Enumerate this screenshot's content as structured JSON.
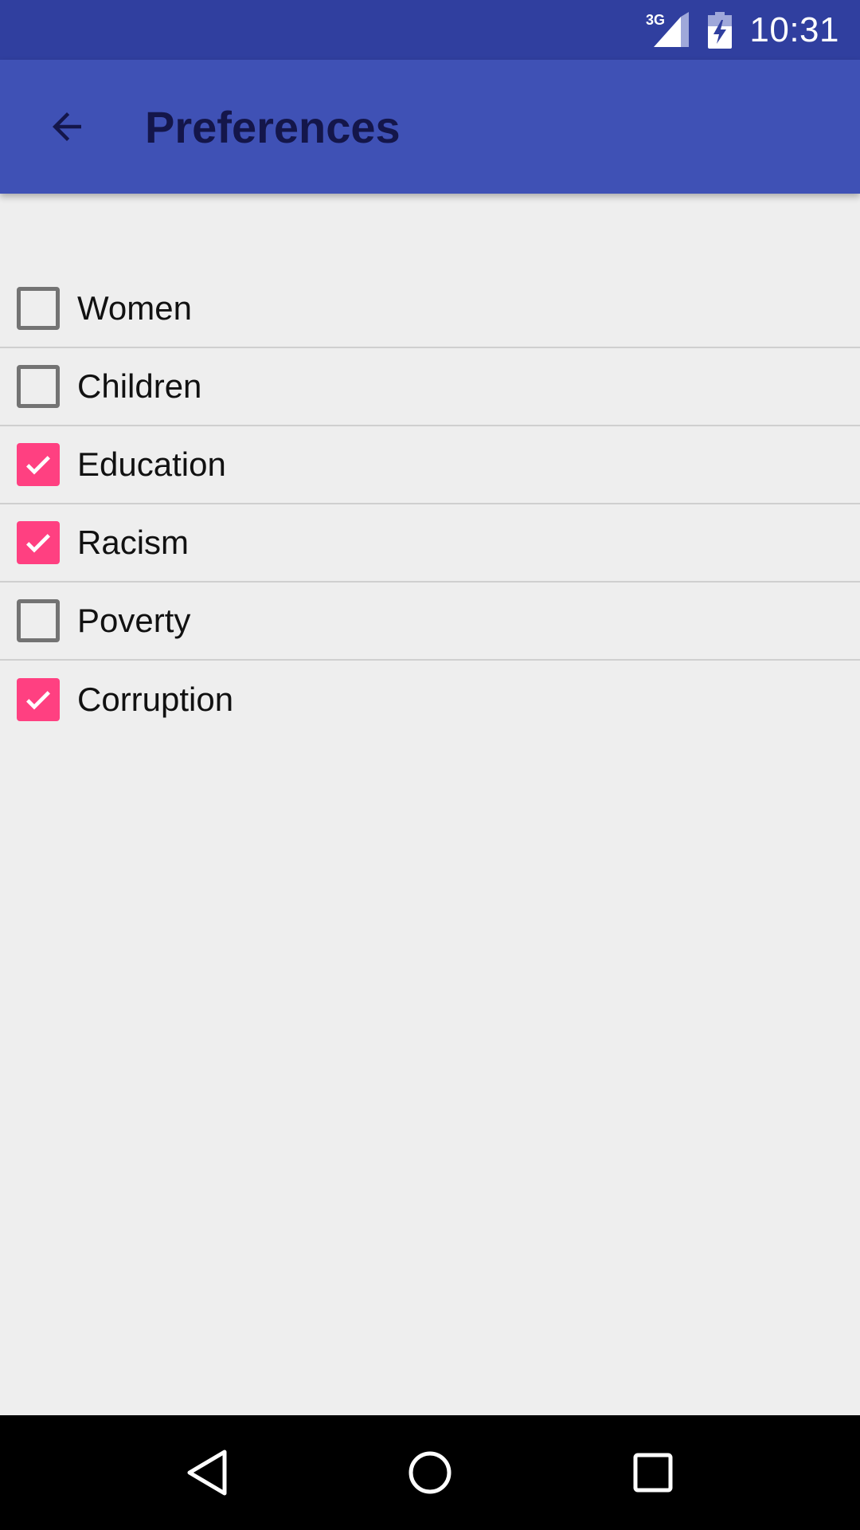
{
  "status_bar": {
    "network_label": "3G",
    "time": "10:31"
  },
  "app_bar": {
    "title": "Preferences",
    "back_icon": "arrow-back-icon"
  },
  "preferences": [
    {
      "label": "Women",
      "checked": false
    },
    {
      "label": "Children",
      "checked": false
    },
    {
      "label": "Education",
      "checked": true
    },
    {
      "label": "Racism",
      "checked": true
    },
    {
      "label": "Poverty",
      "checked": false
    },
    {
      "label": "Corruption",
      "checked": true
    }
  ],
  "colors": {
    "status_bar": "#303f9f",
    "app_bar": "#3f51b5",
    "checkbox_checked": "#ff4081",
    "checkbox_unchecked": "#737373",
    "background": "#eeeeee"
  },
  "nav_bar": {
    "back": "nav-back-icon",
    "home": "nav-home-icon",
    "recents": "nav-recents-icon"
  }
}
